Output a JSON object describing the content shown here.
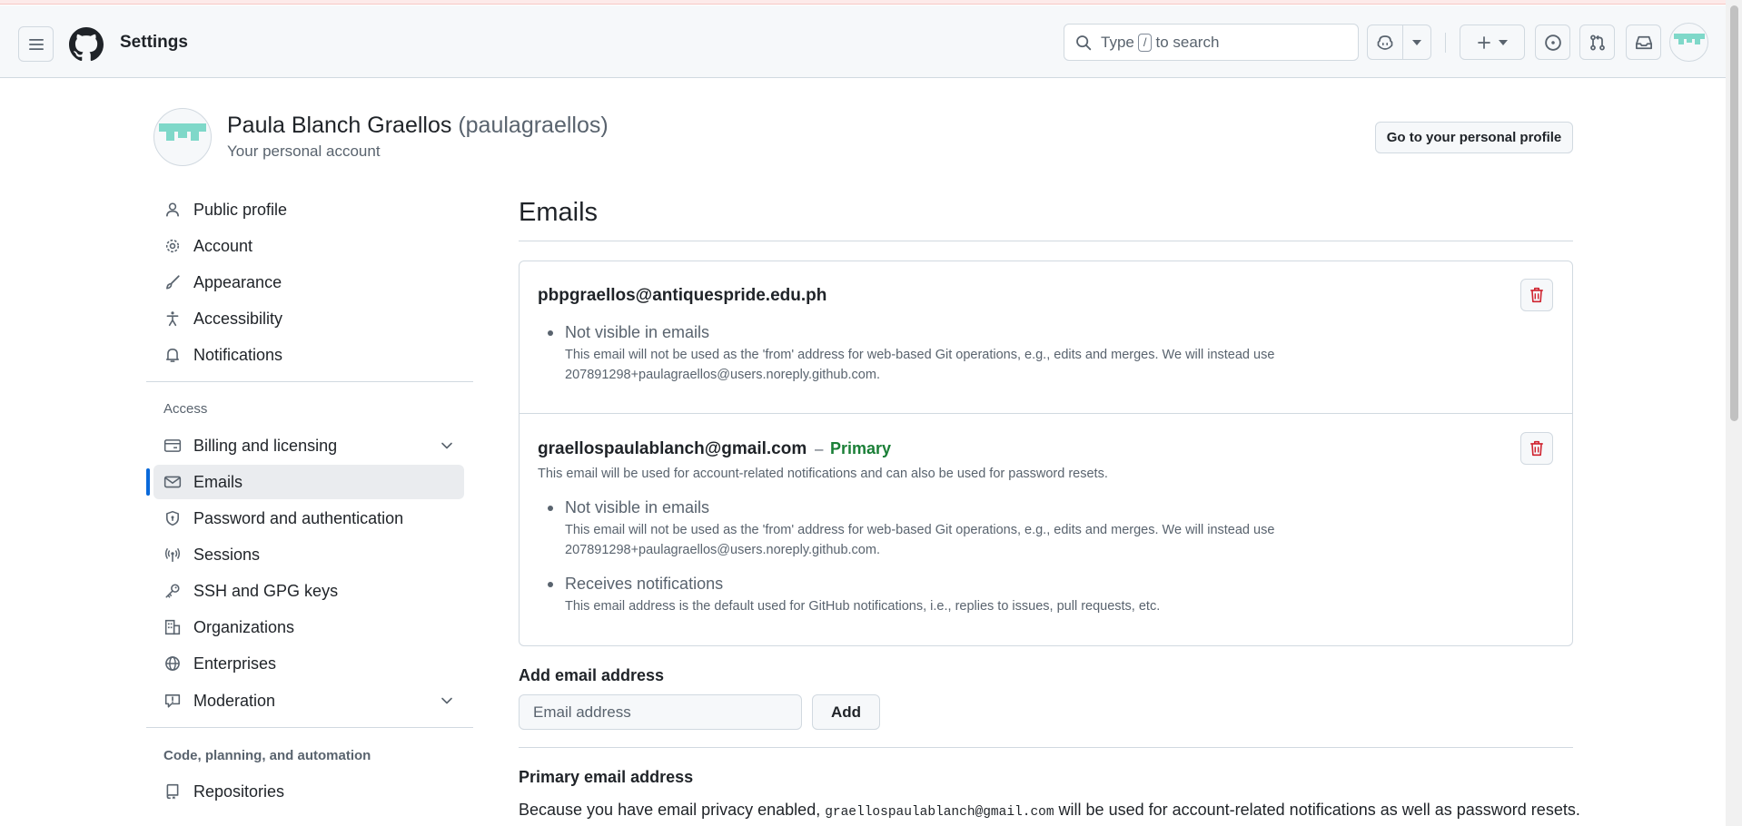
{
  "header": {
    "title": "Settings",
    "search_prefix": "Type",
    "search_key": "/",
    "search_suffix": "to search"
  },
  "profile": {
    "name": "Paula Blanch Graellos",
    "login": "(paulagraellos)",
    "subtitle": "Your personal account",
    "go_profile_label": "Go to your personal profile"
  },
  "sidebar": {
    "items": [
      {
        "label": "Public profile",
        "icon": "person-icon"
      },
      {
        "label": "Account",
        "icon": "gear-icon"
      },
      {
        "label": "Appearance",
        "icon": "paintbrush-icon"
      },
      {
        "label": "Accessibility",
        "icon": "accessibility-icon"
      },
      {
        "label": "Notifications",
        "icon": "bell-icon"
      }
    ],
    "access_heading": "Access",
    "access_items": [
      {
        "label": "Billing and licensing",
        "icon": "credit-card-icon"
      },
      {
        "label": "Emails",
        "icon": "mail-icon"
      },
      {
        "label": "Password and authentication",
        "icon": "shield-lock-icon"
      },
      {
        "label": "Sessions",
        "icon": "broadcast-icon"
      },
      {
        "label": "SSH and GPG keys",
        "icon": "key-icon"
      },
      {
        "label": "Organizations",
        "icon": "organization-icon"
      },
      {
        "label": "Enterprises",
        "icon": "globe-icon"
      },
      {
        "label": "Moderation",
        "icon": "report-icon"
      }
    ],
    "code_heading": "Code, planning, and automation",
    "code_items": [
      {
        "label": "Repositories",
        "icon": "repo-icon"
      }
    ]
  },
  "main": {
    "title": "Emails",
    "emails": [
      {
        "address": "pbpgraellos@antiquespride.edu.ph",
        "bullets": [
          {
            "title": "Not visible in emails",
            "line1": "This email will not be used as the 'from' address for web-based Git operations, e.g., edits and merges. We will instead use",
            "line2": "207891298+paulagraellos@users.noreply.github.com."
          }
        ]
      },
      {
        "address": "graellospaulablanch@gmail.com",
        "separator": "–",
        "primary_label": "Primary",
        "note": "This email will be used for account-related notifications and can also be used for password resets.",
        "bullets": [
          {
            "title": "Not visible in emails",
            "line1": "This email will not be used as the 'from' address for web-based Git operations, e.g., edits and merges. We will instead use",
            "line2": "207891298+paulagraellos@users.noreply.github.com."
          },
          {
            "title": "Receives notifications",
            "line1": "This email address is the default used for GitHub notifications, i.e., replies to issues, pull requests, etc."
          }
        ]
      }
    ],
    "add_heading": "Add email address",
    "add_placeholder": "Email address",
    "add_button": "Add",
    "primary_heading": "Primary email address",
    "primary_text_before": "Because you have email privacy enabled, ",
    "primary_text_code": "graellospaulablanch@gmail.com",
    "primary_text_after": " will be used for account-related notifications as well as password resets."
  },
  "colors": {
    "accent": "#0969da",
    "primary_green": "#1a7f37",
    "danger": "#cf222e",
    "avatar_teal": "#7fd8c9"
  }
}
